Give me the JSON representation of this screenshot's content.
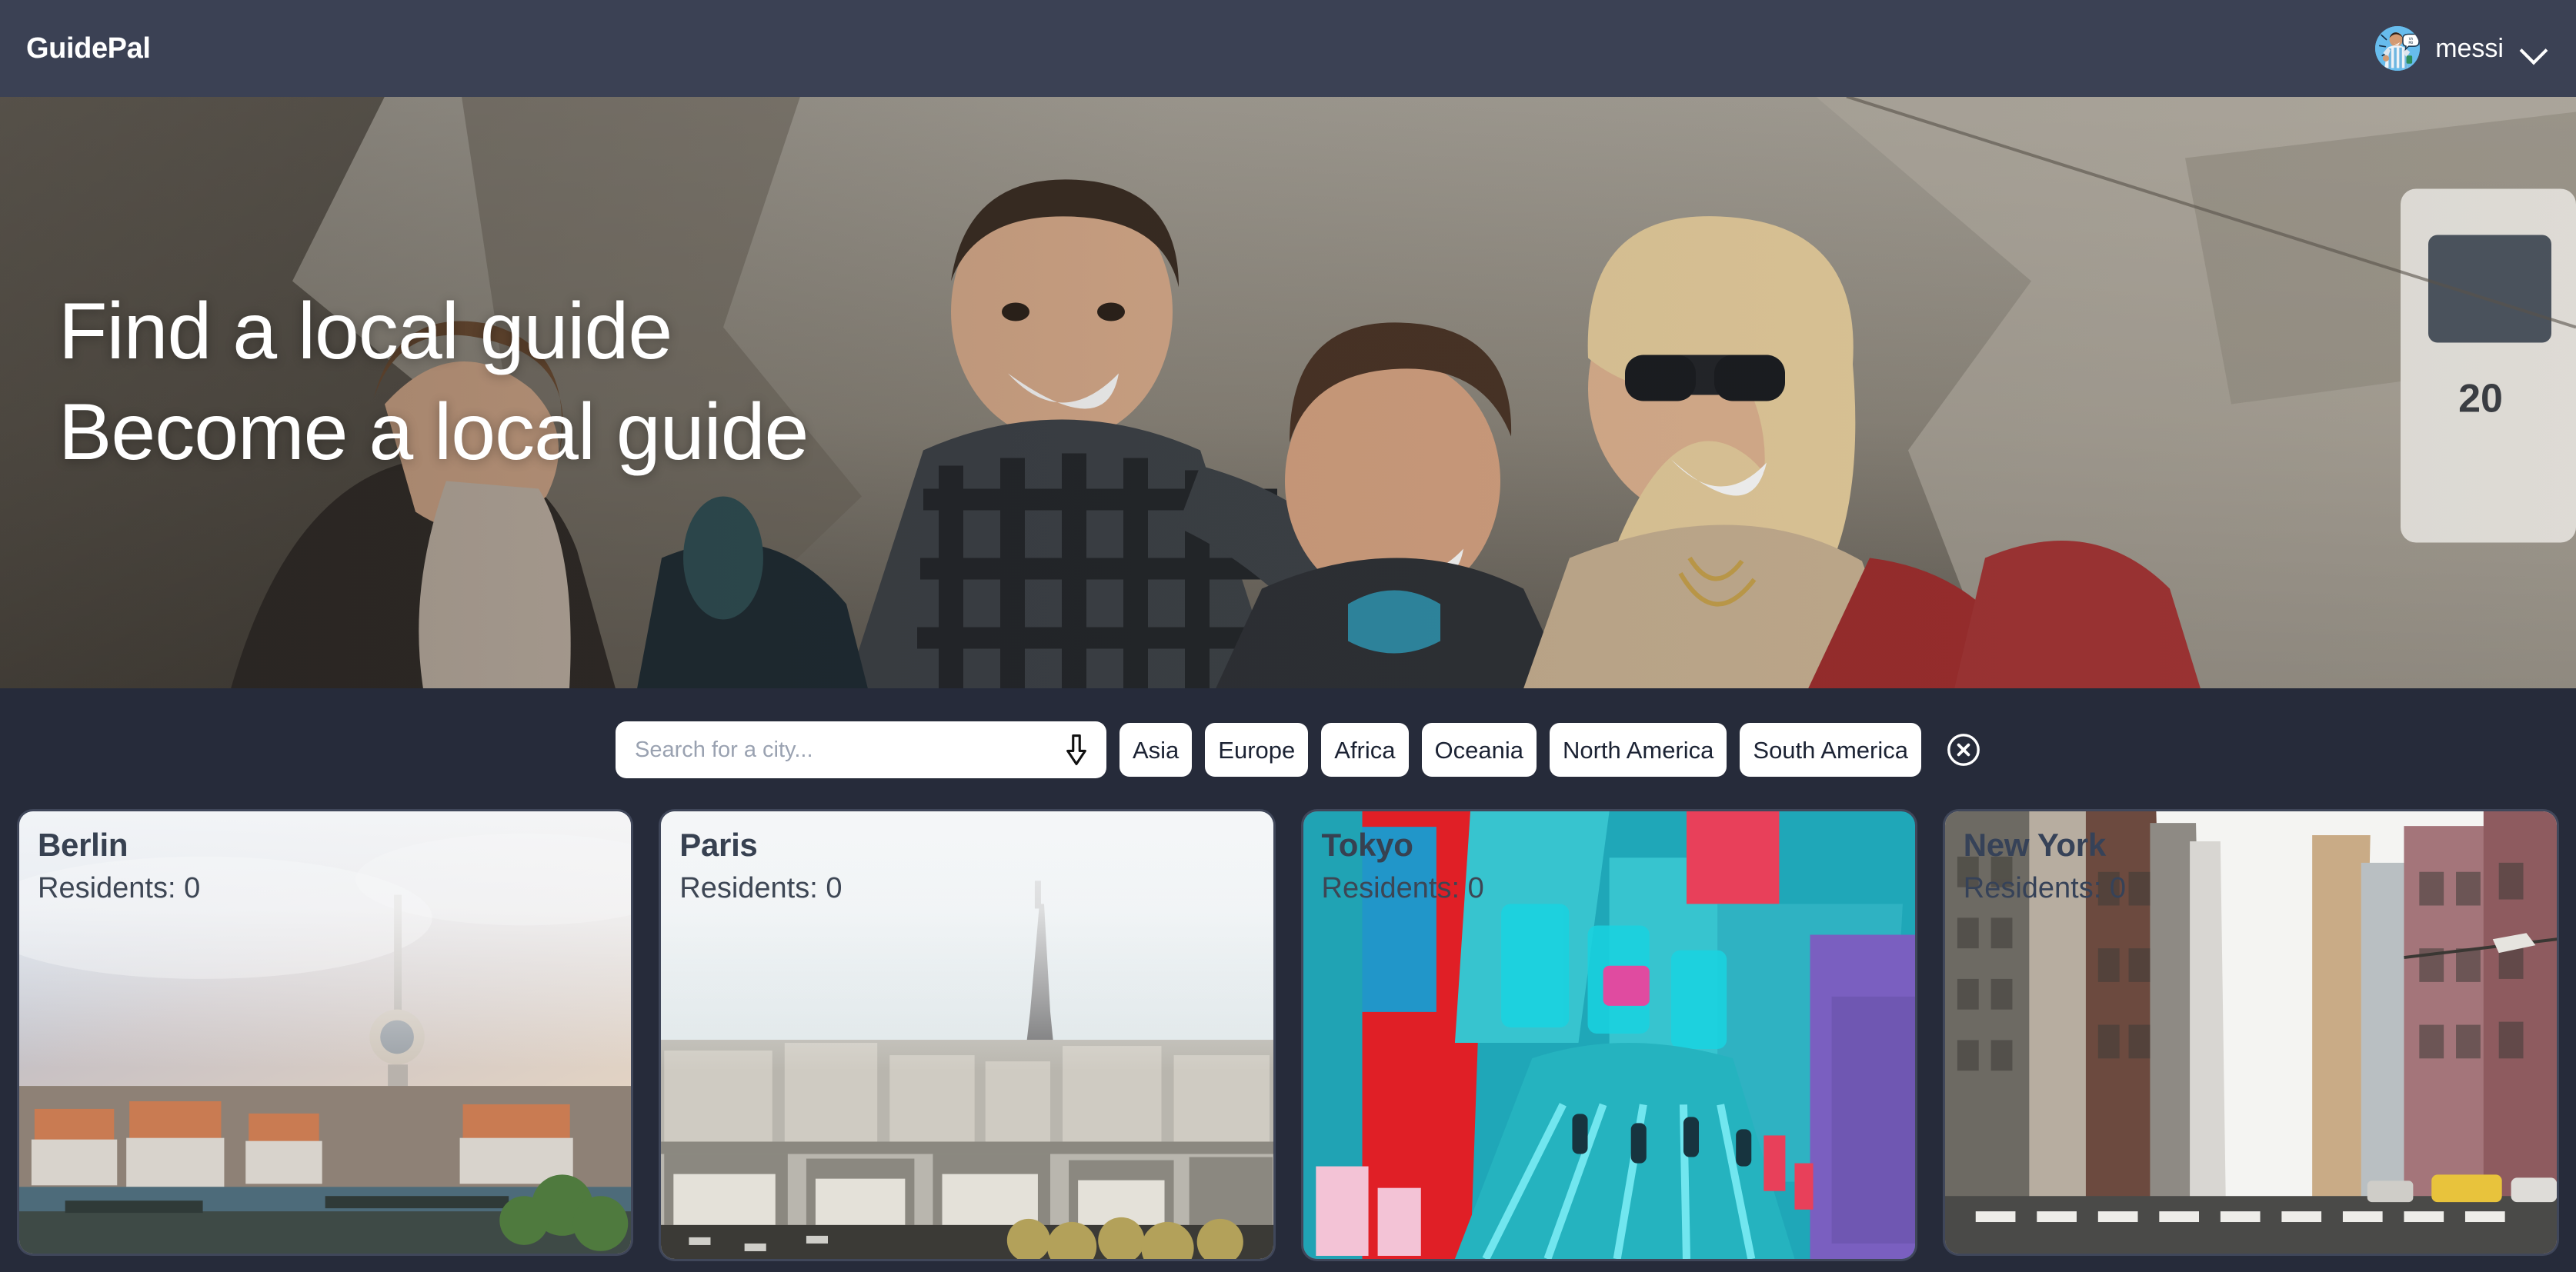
{
  "header": {
    "brand": "GuidePal",
    "user": {
      "name": "messi",
      "avatar_icon": "avatar-messi-celebrating",
      "chevron_icon": "chevron-down-icon"
    }
  },
  "hero": {
    "title": "Find a local guide\nBecome a local guide",
    "image_alt": "four-backpackers-laughing-mountain-trail"
  },
  "filters": {
    "search": {
      "placeholder": "Search for a city...",
      "value": "",
      "icon": "arrow-down-icon"
    },
    "continents": [
      {
        "label": "Asia"
      },
      {
        "label": "Europe"
      },
      {
        "label": "Africa"
      },
      {
        "label": "Oceania"
      },
      {
        "label": "North America"
      },
      {
        "label": "South America"
      }
    ],
    "clear": {
      "icon": "close-circle-icon",
      "label": ""
    }
  },
  "cities": [
    {
      "name": "Berlin",
      "residents_label": "Residents: 0",
      "image_alt": "berlin-tv-tower-river-skyline",
      "scrim": true
    },
    {
      "name": "Paris",
      "residents_label": "Residents: 0",
      "image_alt": "paris-rooftops-eiffel-tower",
      "scrim": true
    },
    {
      "name": "Tokyo",
      "residents_label": "Residents: 0",
      "image_alt": "tokyo-neon-shopping-street",
      "scrim": false
    },
    {
      "name": "New York",
      "residents_label": "Residents: 0",
      "image_alt": "new-york-street-canyon-buildings",
      "scrim": false
    }
  ],
  "colors": {
    "header_bg": "#3b4154",
    "filter_bar_bg": "#262b3a",
    "chip_bg": "#ffffff",
    "chip_text": "#1b2233",
    "card_title": "#374151"
  }
}
